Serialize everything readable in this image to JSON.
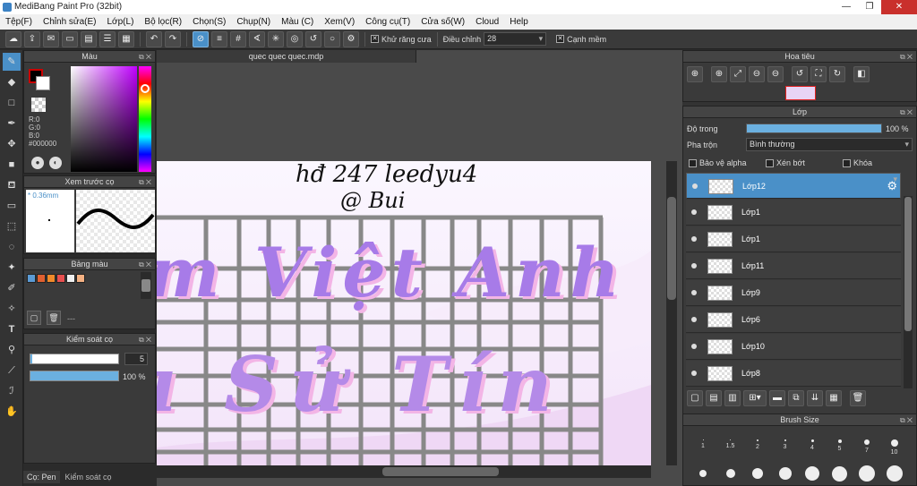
{
  "window": {
    "title": "MediBang Paint Pro (32bit)",
    "min": "—",
    "max": "❐",
    "close": "✕"
  },
  "menu": [
    "Tệp(F)",
    "Chỉnh sửa(E)",
    "Lớp(L)",
    "Bộ lọc(R)",
    "Chọn(S)",
    "Chụp(N)",
    "Màu (C)",
    "Xem(V)",
    "Công cụ(T)",
    "Cửa số(W)",
    "Cloud",
    "Help"
  ],
  "toolbar": {
    "antialias_label": "Khử răng cưa",
    "adjust_label": "Điều chỉnh",
    "adjust_value": "28",
    "edge_label": "Cạnh mềm"
  },
  "color_panel": {
    "title": "Màu",
    "r": "R:0",
    "g": "G:0",
    "b": "B:0",
    "hex": "#000000"
  },
  "brush_preview": {
    "title": "Xem trước cọ",
    "size": "0.36mm"
  },
  "palette": {
    "title": "Bảng màu",
    "dash": "---",
    "swatches": [
      "#5b9bd5",
      "#e06030",
      "#f08a2a",
      "#e85050",
      "#f0f0f0",
      "#f4b183"
    ]
  },
  "brush_control": {
    "title": "Kiểm soát cọ",
    "size_value": "5",
    "opacity_value": "100 %",
    "size_fraction": 0.02,
    "opacity_fraction": 1.0
  },
  "bottom_tabs": [
    "Cọ: Pen",
    "Kiểm soát cọ"
  ],
  "document": {
    "tab": "quec quec quec.mdp",
    "text_line1": "hđ 247  leedyu4",
    "text_line2": "@ Bui",
    "big_row1": "m Việt Anh",
    "big_row2": "ı  Sử Tín"
  },
  "navigator": {
    "title": "Hoa tiêu"
  },
  "layer_panel": {
    "title": "Lớp",
    "opacity_label": "Độ trong",
    "opacity_value": "100 %",
    "opacity_fraction": 1.0,
    "blend_label": "Pha trộn",
    "blend_value": "Bình thường",
    "protect_alpha": "Bảo vệ alpha",
    "clipping": "Xén bớt",
    "lock": "Khóa",
    "layers": [
      {
        "name": "Lớp12",
        "selected": true
      },
      {
        "name": "Lớp1",
        "selected": false
      },
      {
        "name": "Lớp1",
        "selected": false
      },
      {
        "name": "Lớp11",
        "selected": false
      },
      {
        "name": "Lớp9",
        "selected": false
      },
      {
        "name": "Lớp6",
        "selected": false
      },
      {
        "name": "Lớp10",
        "selected": false
      },
      {
        "name": "Lớp8",
        "selected": false
      }
    ]
  },
  "brush_size": {
    "title": "Brush Size",
    "labels": [
      "1",
      "1.5",
      "2",
      "3",
      "4",
      "5",
      "7",
      "10"
    ]
  },
  "colors": {
    "accent": "#4a90c8",
    "panel_bg": "#3a3a3a",
    "lettering": "#b070e0"
  }
}
